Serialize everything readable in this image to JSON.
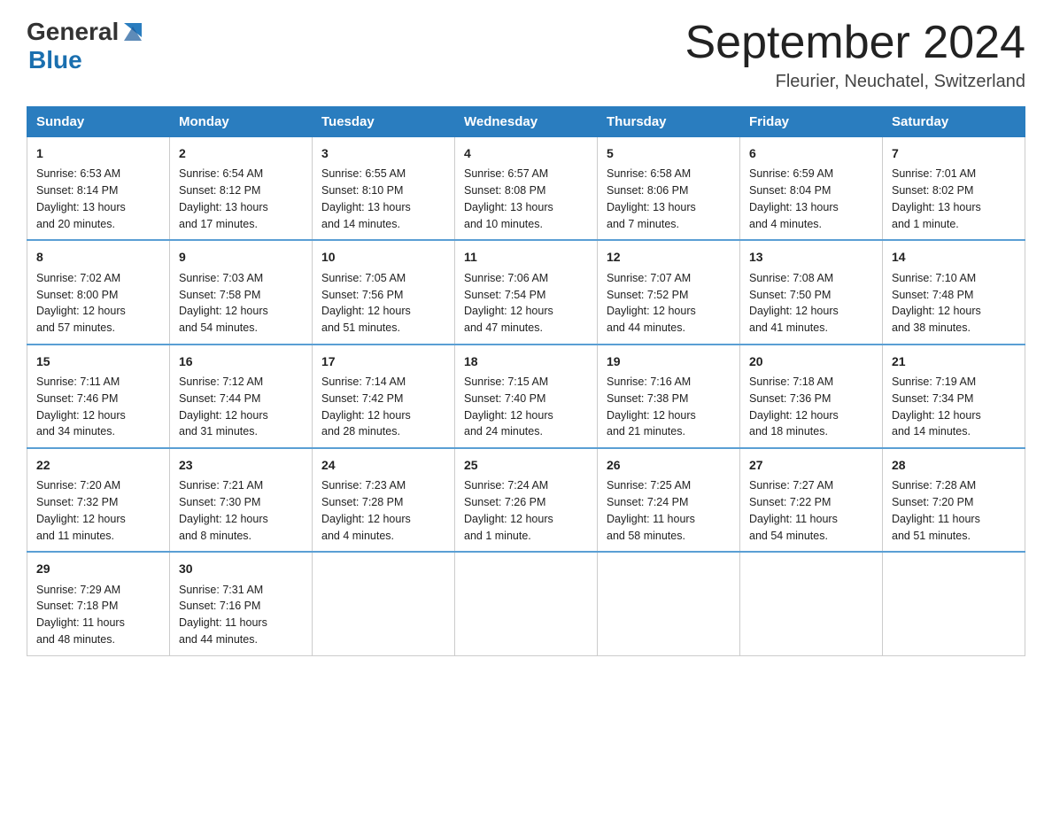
{
  "logo": {
    "text_general": "General",
    "text_blue": "Blue"
  },
  "header": {
    "month_year": "September 2024",
    "location": "Fleurier, Neuchatel, Switzerland"
  },
  "days_of_week": [
    "Sunday",
    "Monday",
    "Tuesday",
    "Wednesday",
    "Thursday",
    "Friday",
    "Saturday"
  ],
  "weeks": [
    [
      {
        "day": "1",
        "info": "Sunrise: 6:53 AM\nSunset: 8:14 PM\nDaylight: 13 hours\nand 20 minutes."
      },
      {
        "day": "2",
        "info": "Sunrise: 6:54 AM\nSunset: 8:12 PM\nDaylight: 13 hours\nand 17 minutes."
      },
      {
        "day": "3",
        "info": "Sunrise: 6:55 AM\nSunset: 8:10 PM\nDaylight: 13 hours\nand 14 minutes."
      },
      {
        "day": "4",
        "info": "Sunrise: 6:57 AM\nSunset: 8:08 PM\nDaylight: 13 hours\nand 10 minutes."
      },
      {
        "day": "5",
        "info": "Sunrise: 6:58 AM\nSunset: 8:06 PM\nDaylight: 13 hours\nand 7 minutes."
      },
      {
        "day": "6",
        "info": "Sunrise: 6:59 AM\nSunset: 8:04 PM\nDaylight: 13 hours\nand 4 minutes."
      },
      {
        "day": "7",
        "info": "Sunrise: 7:01 AM\nSunset: 8:02 PM\nDaylight: 13 hours\nand 1 minute."
      }
    ],
    [
      {
        "day": "8",
        "info": "Sunrise: 7:02 AM\nSunset: 8:00 PM\nDaylight: 12 hours\nand 57 minutes."
      },
      {
        "day": "9",
        "info": "Sunrise: 7:03 AM\nSunset: 7:58 PM\nDaylight: 12 hours\nand 54 minutes."
      },
      {
        "day": "10",
        "info": "Sunrise: 7:05 AM\nSunset: 7:56 PM\nDaylight: 12 hours\nand 51 minutes."
      },
      {
        "day": "11",
        "info": "Sunrise: 7:06 AM\nSunset: 7:54 PM\nDaylight: 12 hours\nand 47 minutes."
      },
      {
        "day": "12",
        "info": "Sunrise: 7:07 AM\nSunset: 7:52 PM\nDaylight: 12 hours\nand 44 minutes."
      },
      {
        "day": "13",
        "info": "Sunrise: 7:08 AM\nSunset: 7:50 PM\nDaylight: 12 hours\nand 41 minutes."
      },
      {
        "day": "14",
        "info": "Sunrise: 7:10 AM\nSunset: 7:48 PM\nDaylight: 12 hours\nand 38 minutes."
      }
    ],
    [
      {
        "day": "15",
        "info": "Sunrise: 7:11 AM\nSunset: 7:46 PM\nDaylight: 12 hours\nand 34 minutes."
      },
      {
        "day": "16",
        "info": "Sunrise: 7:12 AM\nSunset: 7:44 PM\nDaylight: 12 hours\nand 31 minutes."
      },
      {
        "day": "17",
        "info": "Sunrise: 7:14 AM\nSunset: 7:42 PM\nDaylight: 12 hours\nand 28 minutes."
      },
      {
        "day": "18",
        "info": "Sunrise: 7:15 AM\nSunset: 7:40 PM\nDaylight: 12 hours\nand 24 minutes."
      },
      {
        "day": "19",
        "info": "Sunrise: 7:16 AM\nSunset: 7:38 PM\nDaylight: 12 hours\nand 21 minutes."
      },
      {
        "day": "20",
        "info": "Sunrise: 7:18 AM\nSunset: 7:36 PM\nDaylight: 12 hours\nand 18 minutes."
      },
      {
        "day": "21",
        "info": "Sunrise: 7:19 AM\nSunset: 7:34 PM\nDaylight: 12 hours\nand 14 minutes."
      }
    ],
    [
      {
        "day": "22",
        "info": "Sunrise: 7:20 AM\nSunset: 7:32 PM\nDaylight: 12 hours\nand 11 minutes."
      },
      {
        "day": "23",
        "info": "Sunrise: 7:21 AM\nSunset: 7:30 PM\nDaylight: 12 hours\nand 8 minutes."
      },
      {
        "day": "24",
        "info": "Sunrise: 7:23 AM\nSunset: 7:28 PM\nDaylight: 12 hours\nand 4 minutes."
      },
      {
        "day": "25",
        "info": "Sunrise: 7:24 AM\nSunset: 7:26 PM\nDaylight: 12 hours\nand 1 minute."
      },
      {
        "day": "26",
        "info": "Sunrise: 7:25 AM\nSunset: 7:24 PM\nDaylight: 11 hours\nand 58 minutes."
      },
      {
        "day": "27",
        "info": "Sunrise: 7:27 AM\nSunset: 7:22 PM\nDaylight: 11 hours\nand 54 minutes."
      },
      {
        "day": "28",
        "info": "Sunrise: 7:28 AM\nSunset: 7:20 PM\nDaylight: 11 hours\nand 51 minutes."
      }
    ],
    [
      {
        "day": "29",
        "info": "Sunrise: 7:29 AM\nSunset: 7:18 PM\nDaylight: 11 hours\nand 48 minutes."
      },
      {
        "day": "30",
        "info": "Sunrise: 7:31 AM\nSunset: 7:16 PM\nDaylight: 11 hours\nand 44 minutes."
      },
      {
        "day": "",
        "info": ""
      },
      {
        "day": "",
        "info": ""
      },
      {
        "day": "",
        "info": ""
      },
      {
        "day": "",
        "info": ""
      },
      {
        "day": "",
        "info": ""
      }
    ]
  ]
}
